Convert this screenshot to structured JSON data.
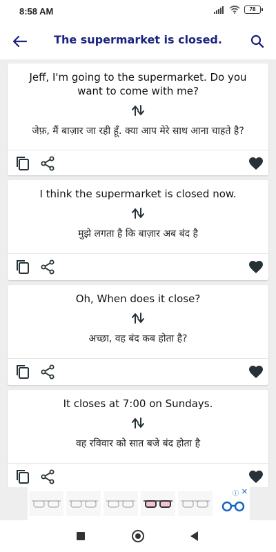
{
  "status_bar": {
    "time": "8:58 AM",
    "battery": "78",
    "icons": [
      "signal-icon",
      "wifi-icon",
      "battery-icon"
    ]
  },
  "app_bar": {
    "title": "The supermarket is closed.",
    "back_icon": "back-arrow-icon",
    "search_icon": "search-icon"
  },
  "cards": [
    {
      "english": "Jeff, I'm going to the supermarket. Do you want to come with me?",
      "hindi": "जेफ़, मैं बाज़ार जा रही हूँ. क्या आप मेरे साथ आना चाहते है?"
    },
    {
      "english": "I think the supermarket is closed now.",
      "hindi": "मुझे लगता है कि बाज़ार अब बंद है"
    },
    {
      "english": "Oh, When does it close?",
      "hindi": "अच्छा, वह बंद कब होता है?"
    },
    {
      "english": "It closes at 7:00 on Sundays.",
      "hindi": "वह रविवार को सात बजे बंद होता है"
    }
  ],
  "card_icons": {
    "copy": "copy-icon",
    "share": "share-icon",
    "favorite": "heart-icon",
    "swap": "swap-arrows-icon"
  },
  "ad": {
    "info_label": "ⓘ",
    "close_label": "✕"
  },
  "colors": {
    "title": "#1a237e",
    "icon": "#263238",
    "background": "#eeeeee"
  }
}
